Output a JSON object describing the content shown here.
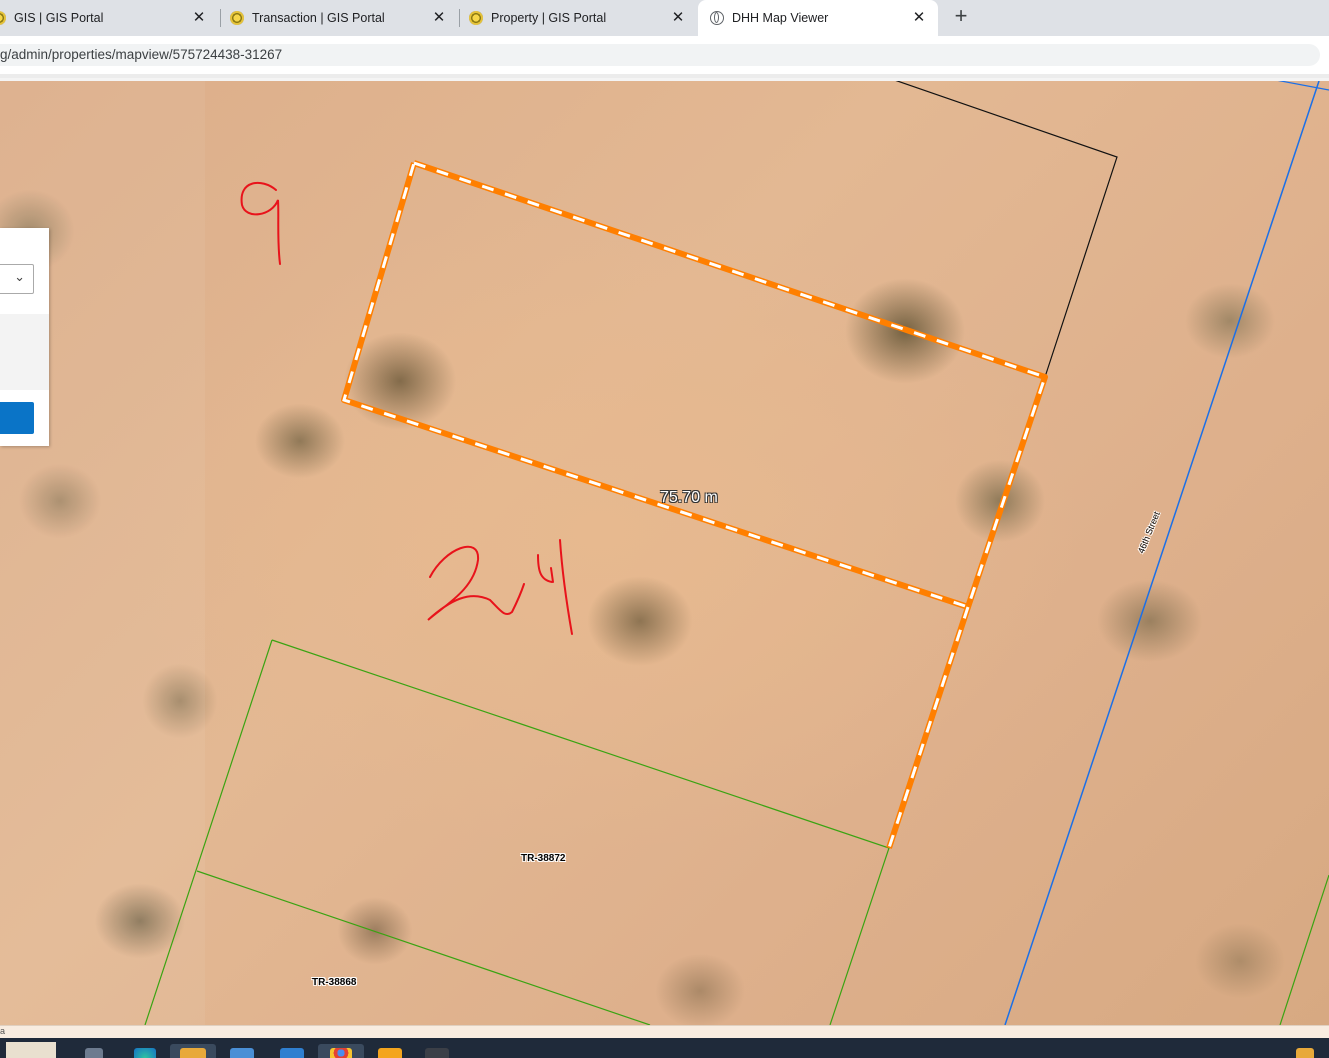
{
  "browser": {
    "tabs": [
      {
        "title": "GIS | GIS Portal",
        "icon": "portal-logo-icon",
        "active": false
      },
      {
        "title": "Transaction | GIS Portal",
        "icon": "portal-logo-icon",
        "active": false
      },
      {
        "title": "Property | GIS Portal",
        "icon": "portal-logo-icon",
        "active": false
      },
      {
        "title": "DHH Map Viewer",
        "icon": "globe-icon",
        "active": true
      }
    ],
    "new_tab_label": "+",
    "close_glyph": "✕",
    "url": "g/admin/properties/mapview/575724438-31267"
  },
  "map": {
    "measurement": "75.70 m",
    "parcels": [
      {
        "label": "TR-38872"
      },
      {
        "label": "TR-38868"
      }
    ],
    "street": "46th Street",
    "annotations": [
      "9",
      "24"
    ],
    "colors": {
      "measure_line": "#ff7f00",
      "parcel_boundary": "#3aa312",
      "street_line": "#1a6fe8",
      "annotation_ink": "#e8131b"
    }
  },
  "panel": {
    "dropdown_glyph": "⌄"
  },
  "status": {
    "attribution": "a"
  }
}
